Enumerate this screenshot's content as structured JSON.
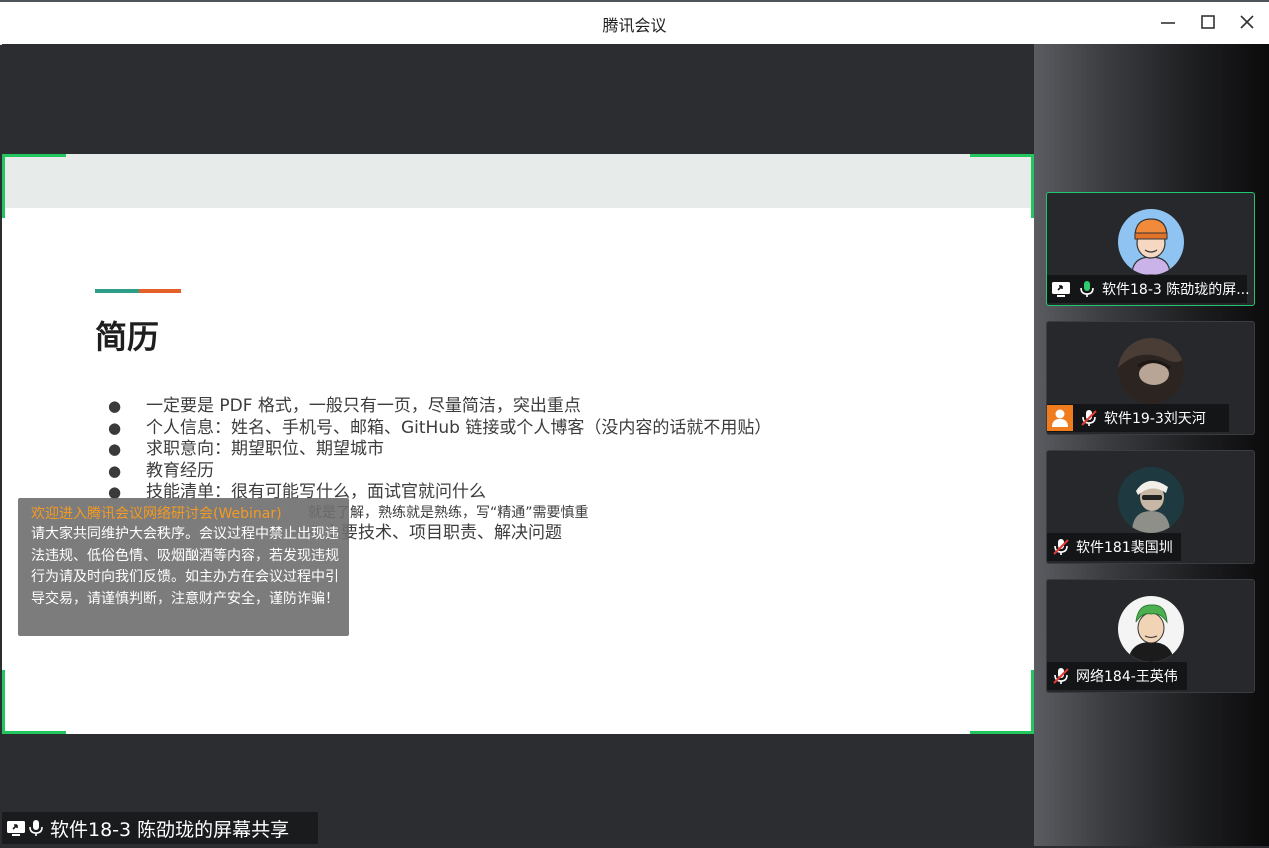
{
  "window": {
    "title": "腾讯会议",
    "minimize_icon": "minimize-icon",
    "maximize_icon": "maximize-icon",
    "close_icon": "close-icon"
  },
  "slide": {
    "title": "简历",
    "bullets": [
      "一定要是 PDF 格式，一般只有一页，尽量简洁，突出重点",
      "个人信息：姓名、手机号、邮箱、GitHub 链接或个人博客（没内容的话就不用贴）",
      "求职意向：期望职位、期望城市",
      "教育经历",
      "技能清单：很有可能写什么，面试官就问什么"
    ],
    "sub_bullet": "就是了解，熟练就是熟练，写“精通”需要慎重",
    "sub_bullet_2": "主要技术、项目职责、解决问题",
    "colors": {
      "accent_teal": "#2f9e87",
      "accent_orange": "#e4602a",
      "corner_green": "#22c55e"
    }
  },
  "notice": {
    "headline": "欢迎进入腾讯会议网络研讨会(Webinar)",
    "body": "请大家共同维护大会秩序。会议过程中禁止出现违法违规、低俗色情、吸烟酗酒等内容，若发现违规行为请及时向我们反馈。如主办方在会议过程中引导交易，请谨慎判断，注意财产安全，谨防诈骗！"
  },
  "share_bar": {
    "label": "软件18-3 陈劭珑的屏幕共享",
    "icons": [
      "screen-share-icon",
      "microphone-icon"
    ]
  },
  "participants": [
    {
      "name": "软件18-3 陈劭珑的屏...",
      "mic": "on",
      "sharing": true,
      "active": true,
      "avatar": "cartoon-boy-avatar"
    },
    {
      "name": "软件19-3刘天河",
      "mic": "muted",
      "sharing": false,
      "active": false,
      "avatar": "photo-avatar",
      "host_badge": true
    },
    {
      "name": "软件181裴国圳",
      "mic": "muted",
      "sharing": false,
      "active": false,
      "avatar": "photo-avatar"
    },
    {
      "name": "网络184-王英伟",
      "mic": "muted",
      "sharing": false,
      "active": false,
      "avatar": "anime-avatar"
    }
  ]
}
